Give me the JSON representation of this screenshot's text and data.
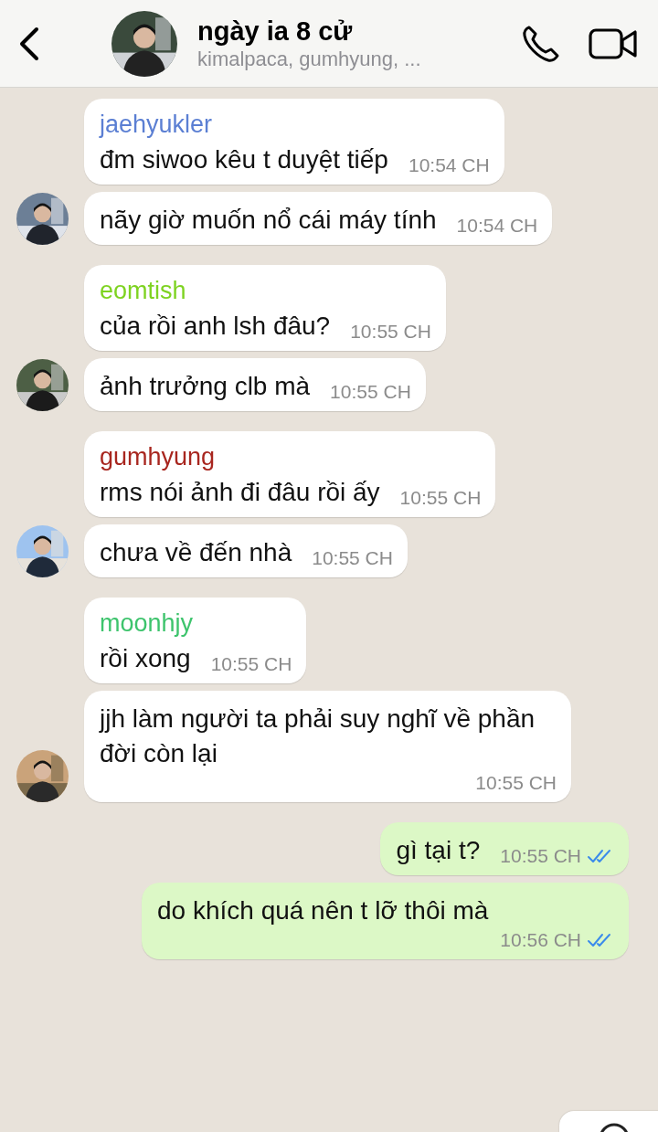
{
  "header": {
    "title": "ngày ia 8 cử",
    "subtitle": "kimalpaca, gumhyung, ..."
  },
  "messages": [
    {
      "kind": "incoming",
      "sender": "jaehyukler",
      "color": "#5b7fd3",
      "text": "đm siwoo kêu t duyệt tiếp",
      "time": "10:54 CH",
      "avatar": false
    },
    {
      "kind": "incoming",
      "text": "nãy giờ muốn nổ cái máy tính",
      "time": "10:54 CH",
      "avatar": true
    },
    {
      "kind": "incoming",
      "sender": "eomtish",
      "color": "#7ed321",
      "text": "của rồi anh lsh đâu?",
      "time": "10:55 CH",
      "avatar": false
    },
    {
      "kind": "incoming",
      "text": "ảnh trưởng clb mà",
      "time": "10:55 CH",
      "avatar": true
    },
    {
      "kind": "incoming",
      "sender": "gumhyung",
      "color": "#a8261f",
      "text": "rms nói ảnh đi đâu rồi ấy",
      "time": "10:55 CH",
      "avatar": false
    },
    {
      "kind": "incoming",
      "text": "chưa về đến nhà",
      "time": "10:55 CH",
      "avatar": true
    },
    {
      "kind": "incoming",
      "sender": "moonhjy",
      "color": "#3ec46d",
      "text": "rồi xong",
      "time": "10:55 CH",
      "avatar": false
    },
    {
      "kind": "incoming",
      "text": "jjh làm người ta phải suy nghĩ về phần đời còn lại",
      "time": "10:55 CH",
      "avatar": true
    },
    {
      "kind": "outgoing",
      "text": "gì tại t?",
      "time": "10:55 CH",
      "read": true
    },
    {
      "kind": "outgoing",
      "text": "do khích quá nên t lỡ thôi mà",
      "time": "10:56 CH",
      "read": true
    }
  ]
}
